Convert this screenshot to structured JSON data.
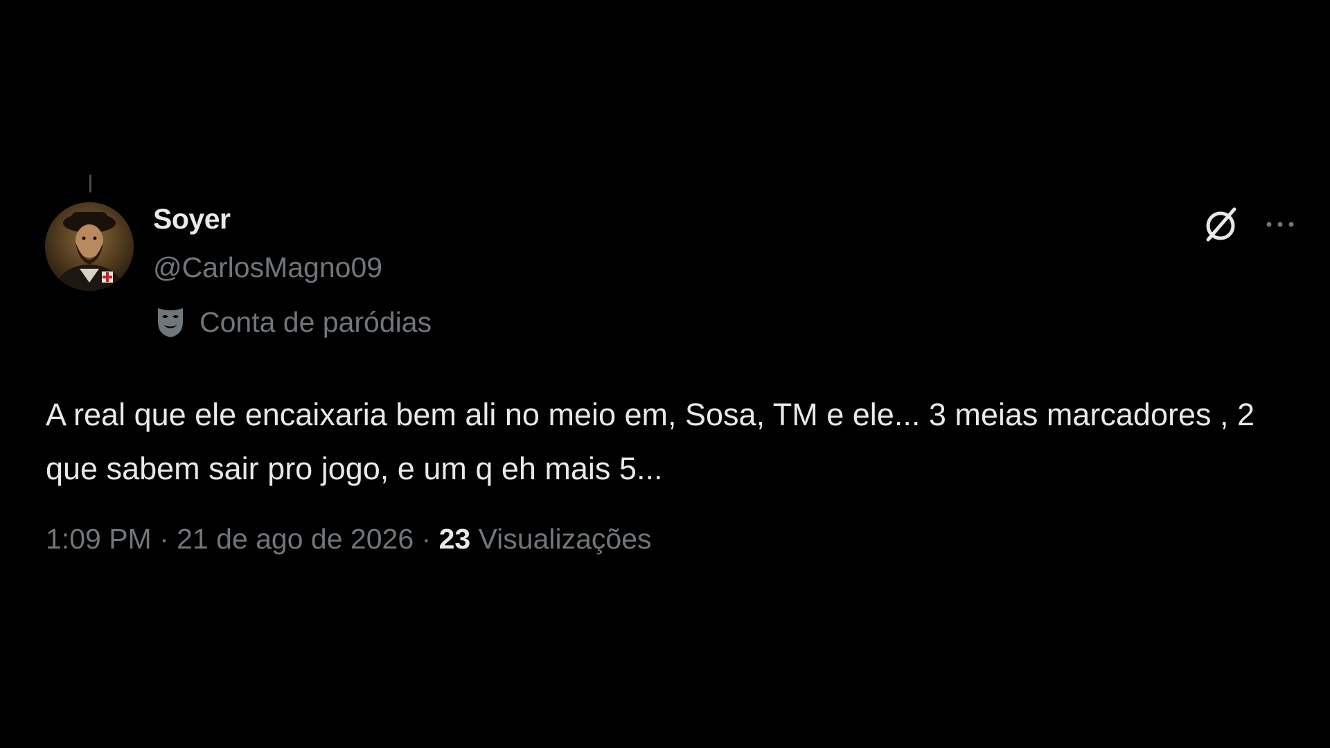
{
  "author": {
    "display_name": "Soyer",
    "handle": "@CarlosMagno09",
    "label": "Conta de paródias"
  },
  "tweet": {
    "text": "A real que ele encaixaria bem ali no meio em, Sosa, TM e ele... 3 meias marcadores , 2 que sabem sair pro jogo, e um q eh mais 5..."
  },
  "meta": {
    "time": "1:09 PM",
    "separator": " · ",
    "date": "21 de ago de 2026",
    "views_count": "23",
    "views_label": " Visualizações"
  },
  "icons": {
    "grok": "grok-icon",
    "more": "more-options-icon",
    "parody": "parody-mask-icon"
  },
  "colors": {
    "background": "#000000",
    "primary_text": "#e7e9ea",
    "secondary_text": "#71767b"
  }
}
